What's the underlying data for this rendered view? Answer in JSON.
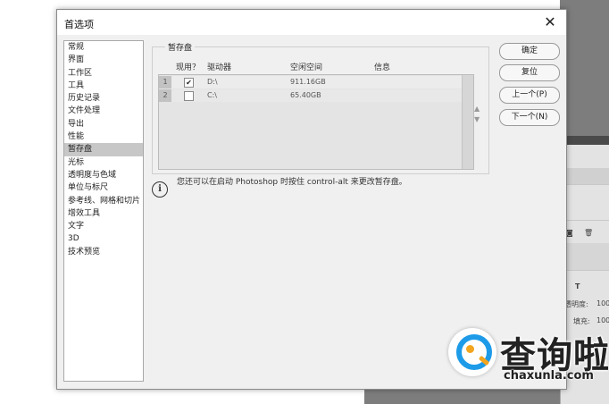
{
  "dialog": {
    "title": "首选项",
    "close_glyph": "✕"
  },
  "sidebar": {
    "items": [
      {
        "label": "常规"
      },
      {
        "label": "界面"
      },
      {
        "label": "工作区"
      },
      {
        "label": "工具"
      },
      {
        "label": "历史记录"
      },
      {
        "label": "文件处理"
      },
      {
        "label": "导出"
      },
      {
        "label": "性能"
      },
      {
        "label": "暂存盘",
        "selected": true
      },
      {
        "label": "光标"
      },
      {
        "label": "透明度与色域"
      },
      {
        "label": "单位与标尺"
      },
      {
        "label": "参考线、网格和切片"
      },
      {
        "label": "增效工具"
      },
      {
        "label": "文字"
      },
      {
        "label": "3D"
      },
      {
        "label": "技术预览"
      }
    ]
  },
  "scratch": {
    "group_title": "暂存盘",
    "columns": [
      "现用？",
      "驱动器",
      "空闲空间",
      "信息"
    ],
    "rows": [
      {
        "num": "1",
        "checked": true,
        "drive": "D:\\",
        "free": "911.16GB",
        "info": ""
      },
      {
        "num": "2",
        "checked": false,
        "drive": "C:\\",
        "free": "65.40GB",
        "info": ""
      }
    ],
    "move_up": "▲",
    "move_down": "▼",
    "check_glyph": "✔"
  },
  "info": {
    "icon_glyph": "i",
    "text": "您还可以在启动 Photoshop 时按住 control-alt 来更改暂存盘。"
  },
  "buttons": {
    "ok": "确定",
    "reset": "复位",
    "prev": "上一个(P)",
    "next": "下一个(N)"
  },
  "ps_panel": {
    "text_tool": "T",
    "opacity_label": "透明度:",
    "opacity_value": "100",
    "fill_label": "填充:",
    "fill_value": "100"
  },
  "watermark": {
    "cn": "查询啦",
    "en": "chaxunla.com"
  },
  "colors": {
    "accent_blue": "#1e9be8",
    "accent_orange": "#f2a51d",
    "selected_item": "#c7c7c7"
  }
}
